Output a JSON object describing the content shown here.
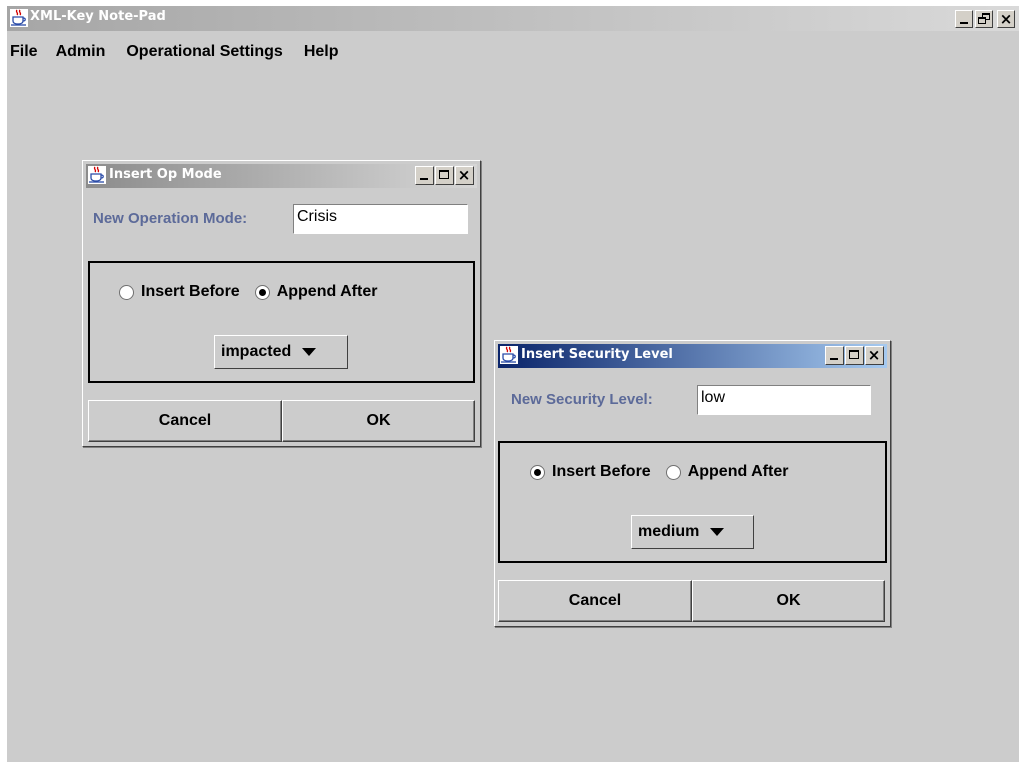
{
  "main_window": {
    "title": "XML-Key Note-Pad",
    "icon": "java-cup-icon",
    "controls": {
      "minimize": "minimize-icon",
      "restore": "restore-icon",
      "close": "close-icon"
    }
  },
  "menubar": {
    "items": [
      "File",
      "Admin",
      "Operational Settings",
      "Help"
    ]
  },
  "dialogs": {
    "op_mode": {
      "title": "Insert Op Mode",
      "state": "inactive",
      "field_label": "New Operation Mode:",
      "field_value": "Crisis",
      "radio_insert_before": "Insert Before",
      "radio_append_after": "Append After",
      "selected_radio": "Append After",
      "combo_value": "impacted",
      "cancel_label": "Cancel",
      "ok_label": "OK"
    },
    "security_level": {
      "title": "Insert Security Level",
      "state": "active",
      "field_label": "New Security Level:",
      "field_value": "low",
      "radio_insert_before": "Insert Before",
      "radio_append_after": "Append After",
      "selected_radio": "Insert Before",
      "combo_value": "medium",
      "cancel_label": "Cancel",
      "ok_label": "OK"
    }
  },
  "colors": {
    "desktop": "#cccccc",
    "label_text": "#5c6a99",
    "active_title_start": "#0a246a",
    "active_title_end": "#a6caf0",
    "inactive_title_start": "#8c8c8c",
    "inactive_title_end": "#d6d6d6"
  }
}
